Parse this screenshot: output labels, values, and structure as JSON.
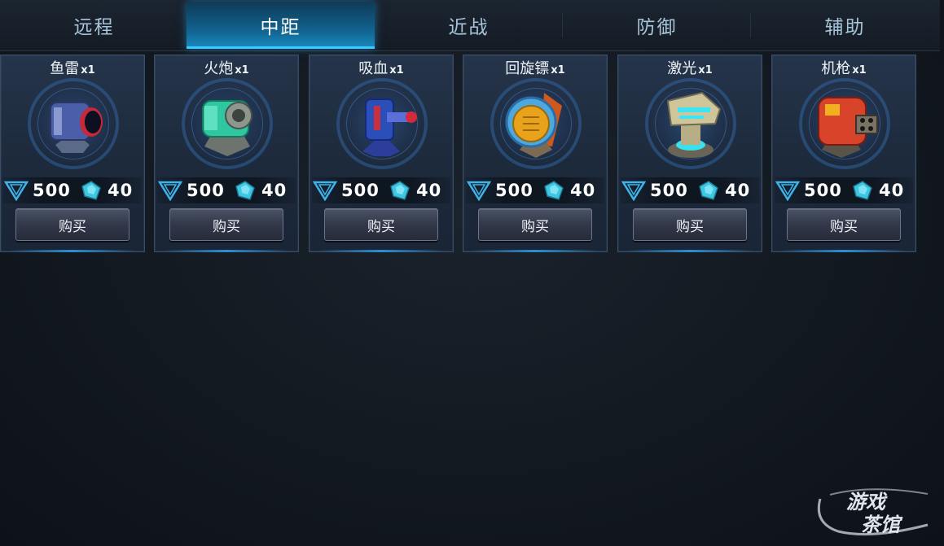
{
  "tabs": [
    {
      "label": "远程",
      "active": false
    },
    {
      "label": "中距",
      "active": true
    },
    {
      "label": "近战",
      "active": false
    },
    {
      "label": "防御",
      "active": false
    },
    {
      "label": "辅助",
      "active": false
    }
  ],
  "items": [
    {
      "name": "鱼雷",
      "qty": "x1",
      "coins": "500",
      "gems": "40",
      "buy_label": "购买",
      "icon": "torpedo-turret-icon",
      "color": "#4a5fa8"
    },
    {
      "name": "火炮",
      "qty": "x1",
      "coins": "500",
      "gems": "40",
      "buy_label": "购买",
      "icon": "cannon-turret-icon",
      "color": "#2fc6a0"
    },
    {
      "name": "吸血",
      "qty": "x1",
      "coins": "500",
      "gems": "40",
      "buy_label": "购买",
      "icon": "vampire-turret-icon",
      "color": "#2a4fb8"
    },
    {
      "name": "回旋镖",
      "qty": "x1",
      "coins": "500",
      "gems": "40",
      "buy_label": "购买",
      "icon": "boomerang-turret-icon",
      "color": "#e8a21c"
    },
    {
      "name": "激光",
      "qty": "x1",
      "coins": "500",
      "gems": "40",
      "buy_label": "购买",
      "icon": "laser-turret-icon",
      "color": "#cfc59a"
    },
    {
      "name": "机枪",
      "qty": "x1",
      "coins": "500",
      "gems": "40",
      "buy_label": "购买",
      "icon": "machinegun-turret-icon",
      "color": "#d8442a"
    }
  ],
  "colors": {
    "accent": "#1a8cc0",
    "coin": "#3fb4ea",
    "gem": "#3fc7e0"
  },
  "watermark": {
    "line1": "游戏",
    "line2": "茶馆"
  }
}
